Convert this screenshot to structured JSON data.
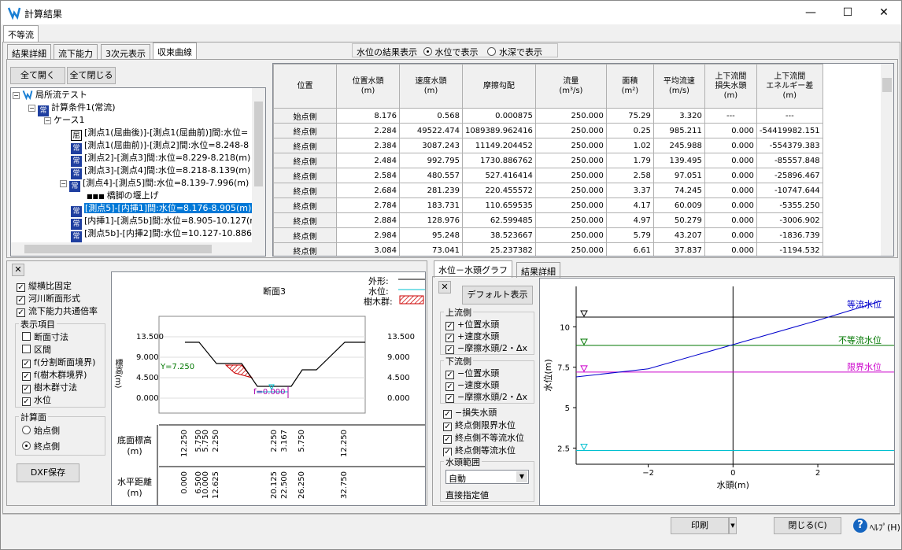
{
  "window": {
    "title": "計算結果"
  },
  "outer_tab": "不等流",
  "tabs": [
    "結果詳細",
    "流下能力",
    "3次元表示",
    "収束曲線"
  ],
  "water_display": {
    "label": "水位の結果表示",
    "opt1": "水位で表示",
    "opt2": "水深で表示"
  },
  "tree_buttons": {
    "expand": "全て開く",
    "collapse": "全て閉じる"
  },
  "tree": [
    {
      "text": "局所流テスト",
      "icon": "app"
    },
    {
      "text": "計算条件1(常流)",
      "icon": "常"
    },
    {
      "text": "ケース1",
      "icon": "none"
    },
    {
      "text": "[測点1(屈曲後)]-[測点1(屈曲前)]間:水位=",
      "icon": "屈"
    },
    {
      "text": "[測点1(屈曲前)]-[測点2]間:水位=8.248-8",
      "icon": "常"
    },
    {
      "text": "[測点2]-[測点3]間:水位=8.229-8.218(m)",
      "icon": "常"
    },
    {
      "text": "[測点3]-[測点4]間:水位=8.218-8.139(m)",
      "icon": "常"
    },
    {
      "text": "[測点4]-[測点5]間:水位=8.139-7.996(m)",
      "icon": "常"
    },
    {
      "text": "橋脚の堰上げ",
      "icon": "dots"
    },
    {
      "text": "[測点5]-[内挿1]間:水位=8.176-8.905(m)",
      "icon": "常"
    },
    {
      "text": "[内挿1]-[測点5b]間:水位=8.905-10.127(m",
      "icon": "常"
    },
    {
      "text": "[測点5b]-[内挿2]間:水位=10.127-10.886(m",
      "icon": "常"
    }
  ],
  "table": {
    "headers": [
      "位置",
      "位置水頭\n(m)",
      "速度水頭\n(m)",
      "摩擦勾配",
      "流量\n(m³/s)",
      "面積\n(m²)",
      "平均流速\n(m/s)",
      "上下流間\n損失水頭\n(m)",
      "上下流間\nエネルギー差\n(m)"
    ],
    "rows": [
      [
        "始点側",
        "8.176",
        "0.568",
        "0.000875",
        "250.000",
        "75.29",
        "3.320",
        "---",
        "---"
      ],
      [
        "終点側",
        "2.284",
        "49522.474",
        "1089389.962416",
        "250.000",
        "0.25",
        "985.211",
        "0.000",
        "-54419982.151"
      ],
      [
        "終点側",
        "2.384",
        "3087.243",
        "11149.204452",
        "250.000",
        "1.02",
        "245.988",
        "0.000",
        "-554379.383"
      ],
      [
        "終点側",
        "2.484",
        "992.795",
        "1730.886762",
        "250.000",
        "1.79",
        "139.495",
        "0.000",
        "-85557.848"
      ],
      [
        "終点側",
        "2.584",
        "480.557",
        "527.416414",
        "250.000",
        "2.58",
        "97.051",
        "0.000",
        "-25896.467"
      ],
      [
        "終点側",
        "2.684",
        "281.239",
        "220.455572",
        "250.000",
        "3.37",
        "74.245",
        "0.000",
        "-10747.644"
      ],
      [
        "終点側",
        "2.784",
        "183.731",
        "110.659535",
        "250.000",
        "4.17",
        "60.009",
        "0.000",
        "-5355.250"
      ],
      [
        "終点側",
        "2.884",
        "128.976",
        "62.599485",
        "250.000",
        "4.97",
        "50.279",
        "0.000",
        "-3006.902"
      ],
      [
        "終点側",
        "2.984",
        "95.248",
        "38.523667",
        "250.000",
        "5.79",
        "43.207",
        "0.000",
        "-1836.739"
      ],
      [
        "終点側",
        "3.084",
        "73.041",
        "25.237382",
        "250.000",
        "6.61",
        "37.837",
        "0.000",
        "-1194.532"
      ]
    ]
  },
  "left_opts": {
    "aspect": "縦横比固定",
    "river": "河川断面形式",
    "common": "流下能力共通倍率",
    "items_label": "表示項目",
    "dim": "断面寸法",
    "section": "区間",
    "split": "f(分割断面境界)",
    "tree_b": "f(樹木群境界)",
    "tree_dim": "樹木群寸法",
    "wl": "水位",
    "calc_label": "計算面",
    "start": "始点側",
    "end": "終点側",
    "dxf": "DXF保存"
  },
  "cross": {
    "title": "断面3",
    "legend_shape": "外形:",
    "legend_wl": "水位:",
    "legend_tree": "樹木群:",
    "yticks": [
      "13.500",
      "9.000",
      "4.500",
      "0.000"
    ],
    "ylabel": "標高(m)",
    "wl_label": "Y=7.250",
    "f_label": "f=0.000",
    "row1_label": "底面標高\n(m)",
    "row1": [
      "12.250",
      "5.750",
      "5.750",
      "2.250",
      "2.250",
      "3.167",
      "5.750",
      "12.250"
    ],
    "row2_label": "水平距離\n(m)",
    "row2": [
      "0.000",
      "6.500",
      "10.000",
      "12.625",
      "20.125",
      "22.500",
      "26.250",
      "32.750"
    ]
  },
  "graph_tabs": [
    "水位－水頭グラフ",
    "結果詳細"
  ],
  "graph_opts": {
    "default": "デフォルト表示",
    "up": "上流側",
    "up1": "+位置水頭",
    "up2": "+速度水頭",
    "up3": "−摩擦水頭/2・Δx",
    "down": "下流側",
    "dn1": "−位置水頭",
    "dn2": "−速度水頭",
    "dn3": "−摩擦水頭/2・Δx",
    "loss": "−損失水頭",
    "crit": "終点側限界水位",
    "nonu": "終点側不等流水位",
    "unif": "終点側等流水位",
    "range": "水頭範囲",
    "auto": "自動",
    "direct": "直接指定値"
  },
  "chart_data": {
    "type": "line",
    "xlabel": "水頭(m)",
    "ylabel": "水位(m)",
    "xticks": [
      "−2",
      "0",
      "2"
    ],
    "yticks": [
      "10",
      "7.5",
      "5",
      "2.5"
    ],
    "series": [
      {
        "name": "等流水位",
        "color": "#0000cc"
      },
      {
        "name": "不等流水位",
        "color": "#007700"
      },
      {
        "name": "限界水位",
        "color": "#cc00cc"
      }
    ]
  },
  "bottom": {
    "print": "印刷",
    "close": "閉じる(C)",
    "help": "ﾍﾙﾌﾟ(H)"
  }
}
